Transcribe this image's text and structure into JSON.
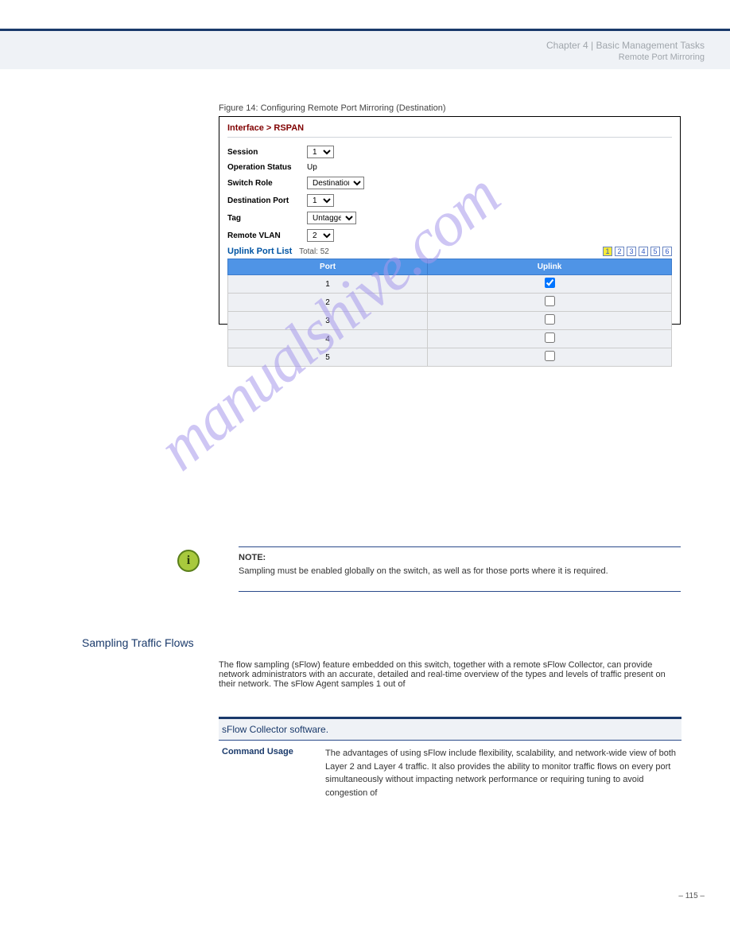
{
  "chapter_label": "Chapter 4 | Basic Management Tasks",
  "chapter_title": "Remote Port Mirroring",
  "figure_caption": "Figure 14: Configuring Remote Port Mirroring (Destination)",
  "screenshot": {
    "breadcrumb_a": "Interface",
    "breadcrumb_b": "RSPAN",
    "fields": {
      "session_label": "Session",
      "session_value": "1",
      "opstatus_label": "Operation Status",
      "opstatus_value": "Up",
      "role_label": "Switch Role",
      "role_value": "Destination",
      "destport_label": "Destination Port",
      "destport_value": "1",
      "tag_label": "Tag",
      "tag_value": "Untagged",
      "remotevlan_label": "Remote VLAN",
      "remotevlan_value": "2"
    },
    "portlist_label": "Uplink Port List",
    "portlist_total": "Total: 52",
    "pages": [
      "1",
      "2",
      "3",
      "4",
      "5",
      "6"
    ],
    "table": {
      "col_port": "Port",
      "col_uplink": "Uplink",
      "rows": [
        {
          "port": "1",
          "checked": true
        },
        {
          "port": "2",
          "checked": false
        },
        {
          "port": "3",
          "checked": false
        },
        {
          "port": "4",
          "checked": false
        },
        {
          "port": "5",
          "checked": false
        }
      ]
    }
  },
  "note": {
    "title": "NOTE:",
    "body": "Sampling must be enabled globally on the switch, as well as for those ports where it is required."
  },
  "flow": {
    "heading": "Sampling Traffic Flows",
    "intro": "The flow sampling (sFlow) feature embedded on this switch, together with a remote sFlow Collector, can provide network administrators with an accurate, detailed and real-time overview of the types and levels of traffic present on their network. The sFlow Agent samples 1 out of",
    "table_header": "sFlow Collector software.",
    "row1_label": "Command Usage",
    "row1_body": "The advantages of using sFlow include flexibility, scalability, and network-wide view of both Layer 2 and Layer 4 traffic. It also provides the ability to monitor traffic flows on every port simultaneously without impacting network performance or requiring tuning to avoid congestion of"
  },
  "watermark_text": "manualshive.com",
  "page_number": "– 115 –"
}
